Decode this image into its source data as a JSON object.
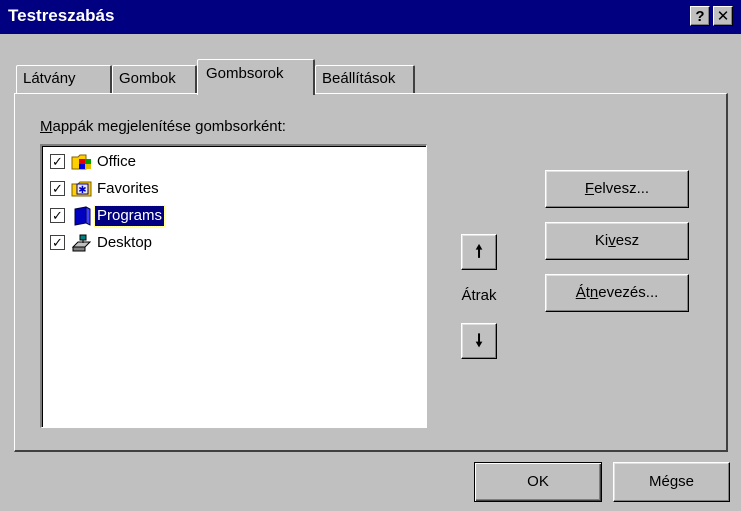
{
  "window": {
    "title": "Testreszabás",
    "help_glyph": "?",
    "close_glyph": "✕"
  },
  "tabs": [
    {
      "label": "Látvány"
    },
    {
      "label": "Gombok"
    },
    {
      "label": "Gombsorok",
      "active": true
    },
    {
      "label": "Beállítások"
    }
  ],
  "list": {
    "label_first": "M",
    "label_rest": "appák megjelenítése gombsorként:",
    "items": [
      {
        "label": "Office",
        "checked": true,
        "icon": "office-folder-icon"
      },
      {
        "label": "Favorites",
        "checked": true,
        "icon": "favorites-folder-icon"
      },
      {
        "label": "Programs",
        "checked": true,
        "icon": "programs-folder-icon",
        "selected": true
      },
      {
        "label": "Desktop",
        "checked": true,
        "icon": "desktop-icon"
      }
    ],
    "check_glyph": "✓"
  },
  "move": {
    "label": "Átrak",
    "up_glyph": "🠕",
    "down_glyph": "🠗"
  },
  "buttons": {
    "add": {
      "accel": "F",
      "rest": "elvesz..."
    },
    "remove": {
      "pre": "Ki",
      "accel": "v",
      "rest": "esz"
    },
    "rename": {
      "accel": "Á",
      "pre2": "t",
      "accel2": "n",
      "rest": "evezés..."
    },
    "ok": "OK",
    "cancel": "Mégse"
  }
}
